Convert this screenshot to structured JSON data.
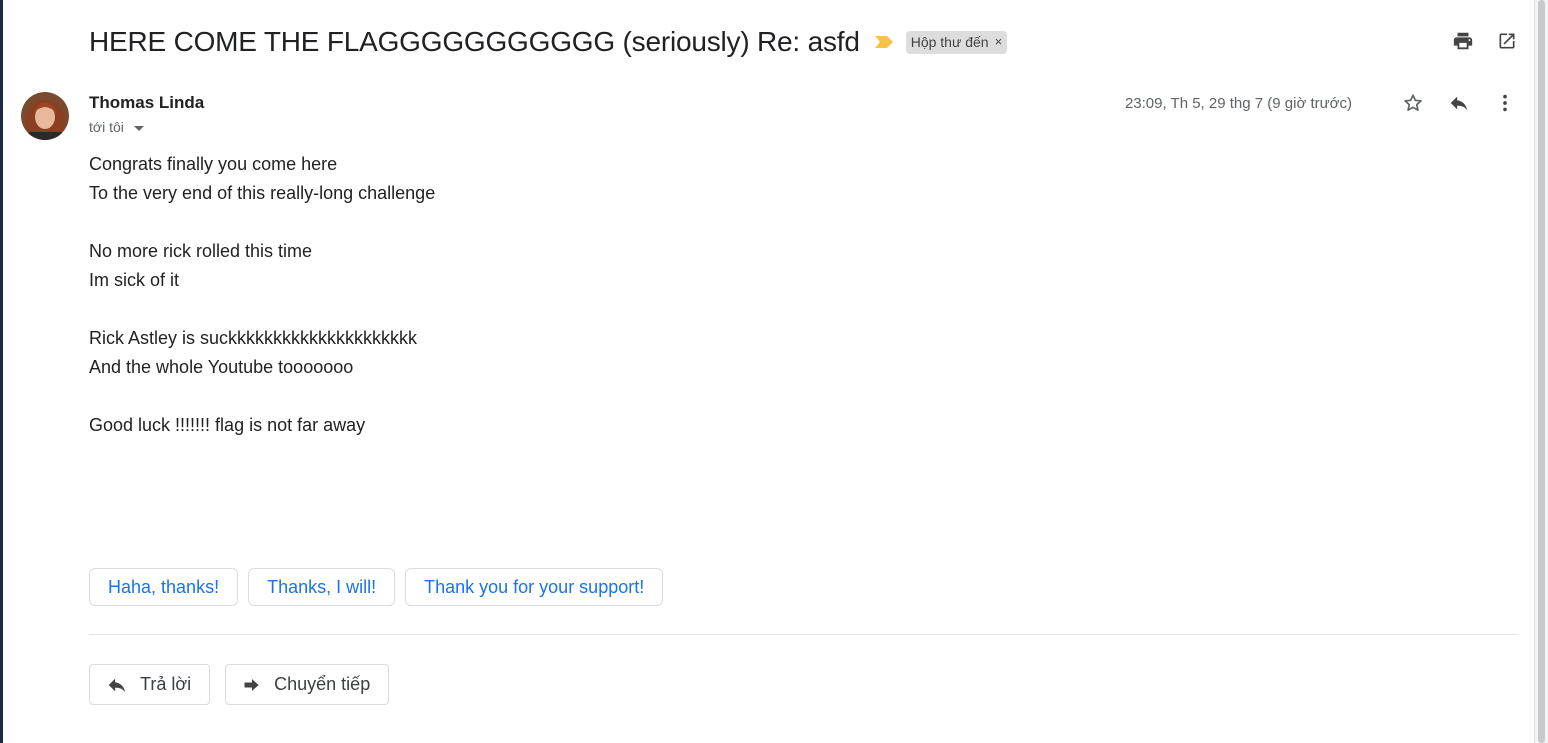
{
  "email": {
    "subject": "HERE COME THE FLAGGGGGGGGGGG (seriously) Re: asfd",
    "label": "Hộp thư đến",
    "label_remove": "×",
    "sender_name": "Thomas Linda",
    "recipient": "tới tôi",
    "date": "23:09, Th 5, 29 thg 7 (9 giờ trước)",
    "body_lines": [
      "Congrats finally you come here",
      "To the very end of this really-long challenge",
      "",
      "No more rick rolled this time",
      "Im sick of it",
      "",
      "Rick Astley is suckkkkkkkkkkkkkkkkkkkkk",
      "And the whole Youtube tooooooo",
      "",
      "Good luck !!!!!!! flag is not far away"
    ]
  },
  "smart_replies": [
    "Haha, thanks!",
    "Thanks, I will!",
    "Thank you for your support!"
  ],
  "actions": {
    "reply": "Trả lời",
    "forward": "Chuyển tiếp"
  },
  "icons": {
    "importance": "importance-marker-icon",
    "print": "print-icon",
    "open_new_window": "open-in-new-window-icon",
    "star": "star-icon",
    "reply": "reply-icon",
    "more": "more-vertical-icon"
  },
  "colors": {
    "accent": "#1a73e8",
    "importance": "#f6c344",
    "chip_border": "#dadce0"
  }
}
